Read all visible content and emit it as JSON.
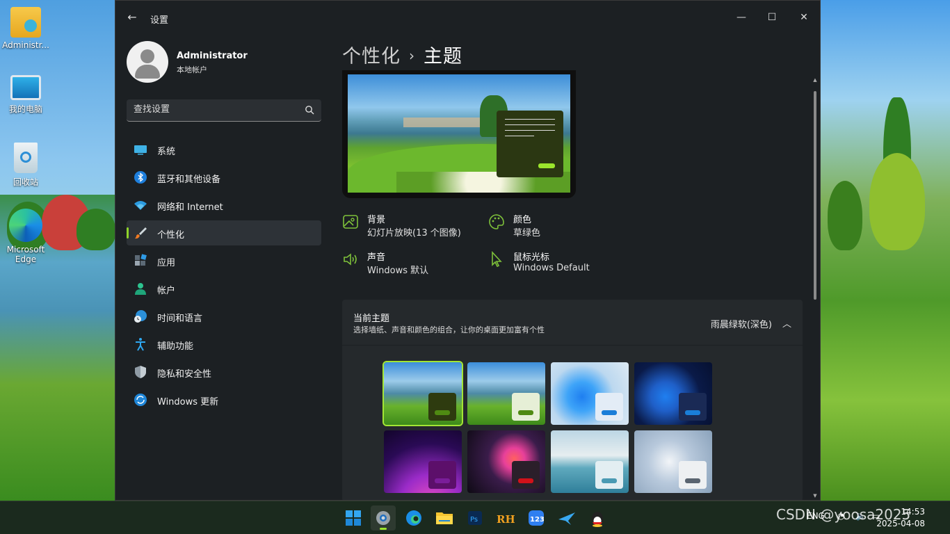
{
  "desktop": {
    "icons": [
      {
        "label": "Administr..."
      },
      {
        "label": "我的电脑"
      },
      {
        "label": "回收站"
      },
      {
        "label": "Microsoft Edge"
      }
    ]
  },
  "window": {
    "title": "设置",
    "controls": {
      "minimize": "—",
      "maximize": "☐",
      "close": "✕"
    }
  },
  "profile": {
    "name": "Administrator",
    "account_type": "本地帐户"
  },
  "search": {
    "placeholder": "查找设置"
  },
  "nav": {
    "items": [
      {
        "label": "系统",
        "icon": "monitor-icon"
      },
      {
        "label": "蓝牙和其他设备",
        "icon": "bluetooth-icon"
      },
      {
        "label": "网络和 Internet",
        "icon": "wifi-icon"
      },
      {
        "label": "个性化",
        "icon": "brush-icon",
        "active": true
      },
      {
        "label": "应用",
        "icon": "apps-icon"
      },
      {
        "label": "帐户",
        "icon": "person-icon"
      },
      {
        "label": "时间和语言",
        "icon": "globe-clock-icon"
      },
      {
        "label": "辅助功能",
        "icon": "accessibility-icon"
      },
      {
        "label": "隐私和安全性",
        "icon": "shield-icon"
      },
      {
        "label": "Windows 更新",
        "icon": "update-icon"
      }
    ]
  },
  "page": {
    "breadcrumb_parent": "个性化",
    "separator": "›",
    "title": "主题"
  },
  "properties": {
    "background": {
      "title": "背景",
      "value": "幻灯片放映(13 个图像)"
    },
    "color": {
      "title": "颜色",
      "value": "草绿色"
    },
    "sound": {
      "title": "声音",
      "value": "Windows 默认"
    },
    "cursor": {
      "title": "鼠标光标",
      "value": "Windows Default"
    }
  },
  "current_theme": {
    "title": "当前主题",
    "description": "选择墙纸、声音和颜色的组合，让你的桌面更加富有个性",
    "value": "雨晨绿软(深色)"
  },
  "themes": [
    {
      "style": "landscape-dark",
      "tile": "#2e3b0f",
      "bar": "#4f8a12",
      "selected": true
    },
    {
      "style": "landscape-light",
      "tile": "#e6efd6",
      "bar": "#4f8a12"
    },
    {
      "style": "bloom-light",
      "tile": "#e3ecf6",
      "bar": "#1a7ed8"
    },
    {
      "style": "bloom-dark",
      "tile": "#1a2a55",
      "bar": "#1a7ed8"
    },
    {
      "style": "glow",
      "tile": "#5c0f6a",
      "bar": "#7a1d9a"
    },
    {
      "style": "flower",
      "tile": "#2b1f2a",
      "bar": "#d1121a"
    },
    {
      "style": "lake",
      "tile": "#e3eef2",
      "bar": "#4a9ab3"
    },
    {
      "style": "flow",
      "tile": "#eef0f2",
      "bar": "#5a6470"
    }
  ],
  "taskbar": {
    "apps": [
      "start-icon",
      "settings-icon",
      "edge-icon",
      "file-explorer-icon",
      "photoshop-icon",
      "rh-icon",
      "123-icon",
      "bird-icon",
      "qq-icon"
    ],
    "lang": "ENG",
    "time": "14:53",
    "date": "2025-04-08"
  },
  "watermark": "CSDN @yoosa2025",
  "colors": {
    "accent": "#8fd32a",
    "window_bg": "#1c2023",
    "card_bg": "#25292c"
  }
}
